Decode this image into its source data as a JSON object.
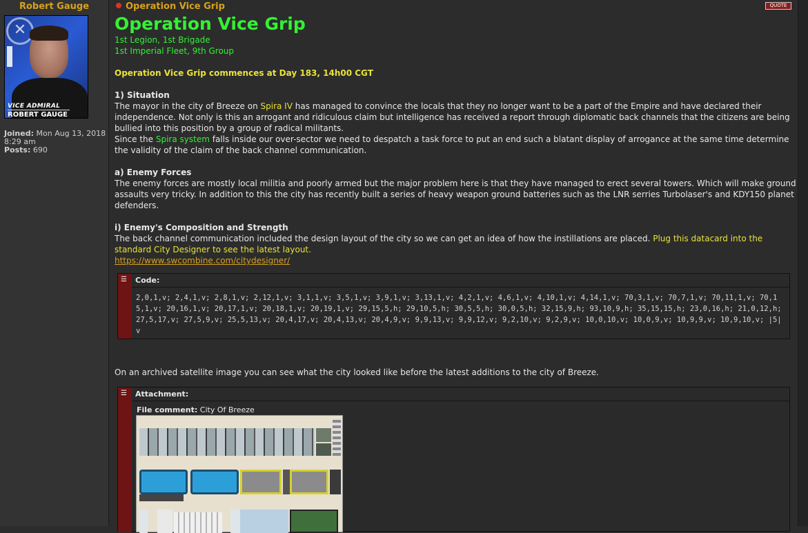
{
  "profile": {
    "author": "Robert Gauge",
    "avatar_rank": "VICE ADMIRAL",
    "avatar_name": "ROBERT GAUGE",
    "joined_label": "Joined:",
    "joined_value": "Mon Aug 13, 2018 8:29 am",
    "posts_label": "Posts:",
    "posts_value": "690"
  },
  "post": {
    "subject": "Operation Vice Grip",
    "quote_label": "QUOTE",
    "title": "Operation Vice Grip",
    "units_line1": "1st Legion, 1st Brigade",
    "units_line2": "1st Imperial Fleet, 9th Group",
    "commence": "Operation Vice Grip commences at Day 183, 14h00 CGT",
    "situation_heading": "1) Situation",
    "situation_p1a": "The mayor in the city of Breeze on ",
    "situation_p1_link": "Spira IV",
    "situation_p1b": " has managed to convince the locals that they no longer want to be a part of the Empire and have declared their independence. Not only is this an arrogant and ridiculous claim but intelligence has received a report through diplomatic back channels that the citizens are being bullied into this position by a group of radical militants.",
    "situation_p2a": "Since the ",
    "situation_p2_link": "Spira system",
    "situation_p2b": " falls inside our over-sector we need to despatch a task force to put an end such a blatant display of arrogance at the same time determine the validity of the claim of the back channel communication.",
    "enemy_heading": "a) Enemy Forces",
    "enemy_text": "The enemy forces are mostly local militia and poorly armed but the major problem here is that they have managed to erect several towers. Which will make ground assaults very tricky. In addition to this the city has recently built a series of heavy weapon ground batteries such as the LNR serries Turbolaser's and KDY150 planet defenders.",
    "composition_heading": "i) Enemy's Composition and Strength",
    "composition_text": "The back channel communication included the design layout of the city so we can get an idea of how the instillations are placed. ",
    "composition_highlight": "Plug this datacard into the standard City Designer to see the latest layout.",
    "composition_url": "https://www.swcombine.com/citydesigner/",
    "code_label": "Code:",
    "code_text": "2,0,1,v; 2,4,1,v; 2,8,1,v; 2,12,1,v; 3,1,1,v; 3,5,1,v; 3,9,1,v; 3,13,1,v; 4,2,1,v; 4,6,1,v; 4,10,1,v; 4,14,1,v; 70,3,1,v; 70,7,1,v; 70,11,1,v; 70,15,1,v; 20,16,1,v; 20,17,1,v; 20,18,1,v; 20,19,1,v; 29,15,5,h; 29,10,5,h; 30,5,5,h; 30,0,5,h; 32,15,9,h; 93,10,9,h; 35,15,15,h; 23,0,16,h; 21,0,12,h; 27,5,17,v; 27,5,9,v; 25,5,13,v; 20,4,17,v; 20,4,13,v; 20,4,9,v; 9,9,13,v; 9,9,12,v; 9,2,10,v; 9,2,9,v; 10,0,10,v; 10,0,9,v; 10,9,9,v; 10,9,10,v; |5|v",
    "archived_text": "On an archived satellite image you can see what the city looked like before the latest additions to the city of Breeze.",
    "attachment_label": "Attachment:",
    "file_comment_label": "File comment:",
    "file_comment_value": "City Of Breeze"
  },
  "colors": {
    "background": "#2c2c2c",
    "author": "#d8a21c",
    "title_green": "#35f035",
    "highlight_yellow": "#e8e23a",
    "code_bar": "#6e1414"
  }
}
